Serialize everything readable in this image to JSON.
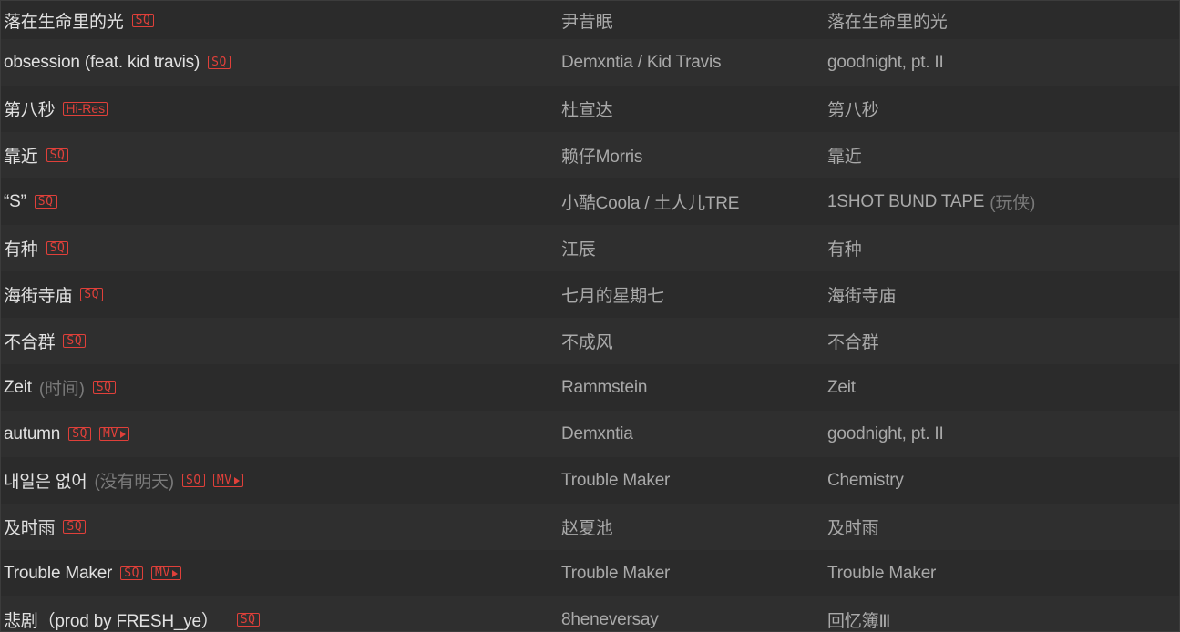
{
  "colors": {
    "background": "#2b2b2b",
    "row_alt": "#2f2f2f",
    "title_text": "#e1e1e1",
    "secondary_text": "#a9a9a9",
    "alias_text": "#7a7a7a",
    "tag_accent": "#e0403a"
  },
  "songs": [
    {
      "title": "落在生命里的光",
      "alias": "",
      "tags": [
        "SQ"
      ],
      "artist": "尹昔眠",
      "album": "落在生命里的光",
      "album_alias": ""
    },
    {
      "title": "obsession (feat. kid travis)",
      "alias": "",
      "tags": [
        "SQ"
      ],
      "artist": "Demxntia / Kid Travis",
      "album": "goodnight, pt. II",
      "album_alias": ""
    },
    {
      "title": "第八秒",
      "alias": "",
      "tags": [
        "Hi-Res"
      ],
      "artist": "杜宣达",
      "album": "第八秒",
      "album_alias": ""
    },
    {
      "title": "靠近",
      "alias": "",
      "tags": [
        "SQ"
      ],
      "artist": "赖仔Morris",
      "album": "靠近",
      "album_alias": ""
    },
    {
      "title": "“S”",
      "alias": "",
      "tags": [
        "SQ"
      ],
      "artist": "小酷Coola / 土人儿TRE",
      "album": "1SHOT BUND TAPE",
      "album_alias": "(玩侠)"
    },
    {
      "title": "有种",
      "alias": "",
      "tags": [
        "SQ"
      ],
      "artist": "江辰",
      "album": "有种",
      "album_alias": ""
    },
    {
      "title": "海街寺庙",
      "alias": "",
      "tags": [
        "SQ"
      ],
      "artist": "七月的星期七",
      "album": "海街寺庙",
      "album_alias": ""
    },
    {
      "title": "不合群",
      "alias": "",
      "tags": [
        "SQ"
      ],
      "artist": "不成风",
      "album": "不合群",
      "album_alias": ""
    },
    {
      "title": "Zeit",
      "alias": "(时间)",
      "tags": [
        "SQ"
      ],
      "artist": "Rammstein",
      "album": "Zeit",
      "album_alias": ""
    },
    {
      "title": "autumn",
      "alias": "",
      "tags": [
        "SQ",
        "MV"
      ],
      "artist": "Demxntia",
      "album": "goodnight, pt. II",
      "album_alias": ""
    },
    {
      "title": "내일은 없어",
      "alias": "(没有明天)",
      "tags": [
        "SQ",
        "MV"
      ],
      "artist": "Trouble Maker",
      "album": "Chemistry",
      "album_alias": ""
    },
    {
      "title": "及时雨",
      "alias": "",
      "tags": [
        "SQ"
      ],
      "artist": "赵夏池",
      "album": "及时雨",
      "album_alias": ""
    },
    {
      "title": "Trouble Maker",
      "alias": "",
      "tags": [
        "SQ",
        "MV"
      ],
      "artist": "Trouble Maker",
      "album": "Trouble Maker",
      "album_alias": ""
    },
    {
      "title": "悲剧（prod by FRESH_ye）",
      "alias": "",
      "tags": [
        "SQ"
      ],
      "artist": "8heneversay",
      "album": "回忆簿Ⅲ",
      "album_alias": ""
    }
  ]
}
